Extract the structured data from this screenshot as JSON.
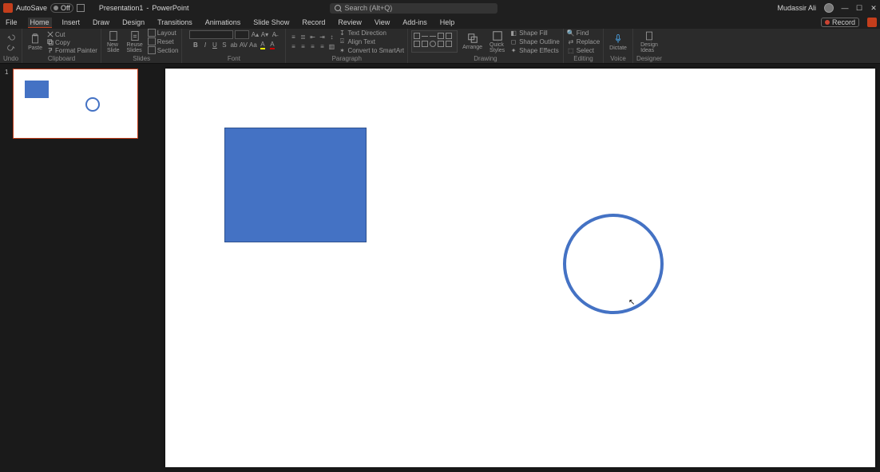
{
  "title": {
    "autosave_label": "AutoSave",
    "autosave_state": "Off",
    "doc_name": "Presentation1",
    "app_name": "PowerPoint",
    "search_placeholder": "Search (Alt+Q)",
    "user_name": "Mudassir Ali"
  },
  "tabs": {
    "file": "File",
    "home": "Home",
    "insert": "Insert",
    "draw": "Draw",
    "design": "Design",
    "transitions": "Transitions",
    "animations": "Animations",
    "slideshow": "Slide Show",
    "record": "Record",
    "review": "Review",
    "view": "View",
    "addins": "Add-ins",
    "help": "Help",
    "record_btn": "Record"
  },
  "ribbon": {
    "undo_group": "Undo",
    "clipboard_group": "Clipboard",
    "clipboard": {
      "paste": "Paste",
      "cut": "Cut",
      "copy": "Copy",
      "fmtpainter": "Format Painter"
    },
    "slides_group": "Slides",
    "slides": {
      "new": "New\nSlide",
      "reuse": "Reuse\nSlides",
      "layout": "Layout",
      "reset": "Reset",
      "section": "Section"
    },
    "font_group": "Font",
    "paragraph_group": "Paragraph",
    "paragraph": {
      "textdir": "Text Direction",
      "align": "Align Text",
      "smartart": "Convert to SmartArt"
    },
    "drawing_group": "Drawing",
    "drawing": {
      "arrange": "Arrange",
      "quick": "Quick\nStyles",
      "fill": "Shape Fill",
      "outline": "Shape Outline",
      "effects": "Shape Effects"
    },
    "editing_group": "Editing",
    "editing": {
      "find": "Find",
      "replace": "Replace",
      "select": "Select"
    },
    "voice_group": "Voice",
    "voice": {
      "dictate": "Dictate"
    },
    "designer_group": "Designer",
    "designer": {
      "ideas": "Design\nIdeas"
    }
  },
  "thumbs": {
    "slide1_num": "1"
  },
  "shapes": {
    "rect_color": "#4472c4",
    "circle_stroke": "#4472c4"
  }
}
